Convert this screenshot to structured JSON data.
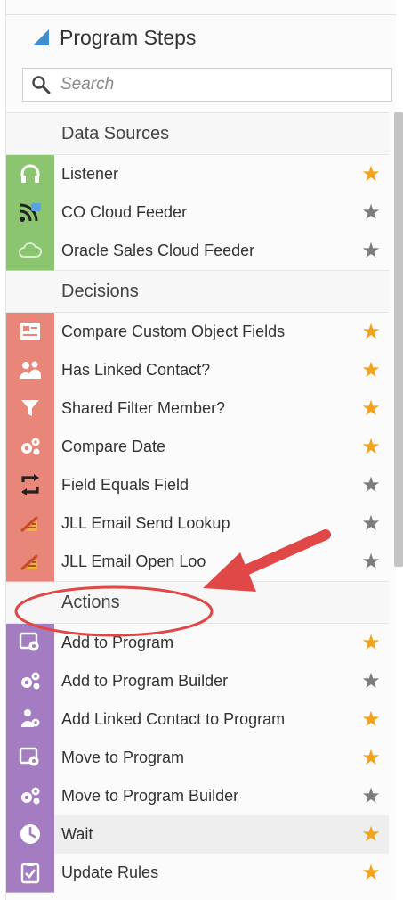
{
  "panel": {
    "title": "Program Steps",
    "search_placeholder": "Search"
  },
  "colors": {
    "data_sources": "#8cc56f",
    "decisions": "#e9867a",
    "actions": "#a37cc1",
    "star_on": "#f2a31c",
    "star_off": "#7c7c7c",
    "annotation": "#e04848"
  },
  "sections": [
    {
      "label": "Data Sources",
      "items": [
        {
          "label": "Listener",
          "icon": "headphones-icon",
          "starred": true
        },
        {
          "label": "CO Cloud Feeder",
          "icon": "feed-icon",
          "starred": false
        },
        {
          "label": "Oracle Sales Cloud Feeder",
          "icon": "cloud-icon",
          "starred": false
        }
      ]
    },
    {
      "label": "Decisions",
      "items": [
        {
          "label": "Compare Custom Object Fields",
          "icon": "form-icon",
          "starred": true
        },
        {
          "label": "Has Linked Contact?",
          "icon": "people-icon",
          "starred": true
        },
        {
          "label": "Shared Filter Member?",
          "icon": "filter-icon",
          "starred": true
        },
        {
          "label": "Compare Date",
          "icon": "gears-icon",
          "starred": true
        },
        {
          "label": "Field Equals Field",
          "icon": "swap-icon",
          "starred": false
        },
        {
          "label": "JLL Email Send Lookup",
          "icon": "tool-icon",
          "starred": false
        },
        {
          "label": "JLL Email Open Loo",
          "icon": "tool-icon",
          "starred": false
        }
      ]
    },
    {
      "label": "Actions",
      "items": [
        {
          "label": "Add to Program",
          "icon": "program-icon",
          "starred": true
        },
        {
          "label": "Add to Program Builder",
          "icon": "gears-icon",
          "starred": false
        },
        {
          "label": "Add Linked Contact to Program",
          "icon": "person-gear-icon",
          "starred": true
        },
        {
          "label": "Move to Program",
          "icon": "program-icon",
          "starred": true
        },
        {
          "label": "Move to Program Builder",
          "icon": "gears-icon",
          "starred": false
        },
        {
          "label": "Wait",
          "icon": "clock-icon",
          "starred": true,
          "highlighted": true
        },
        {
          "label": "Update Rules",
          "icon": "clipboard-check-icon",
          "starred": true
        }
      ]
    }
  ]
}
